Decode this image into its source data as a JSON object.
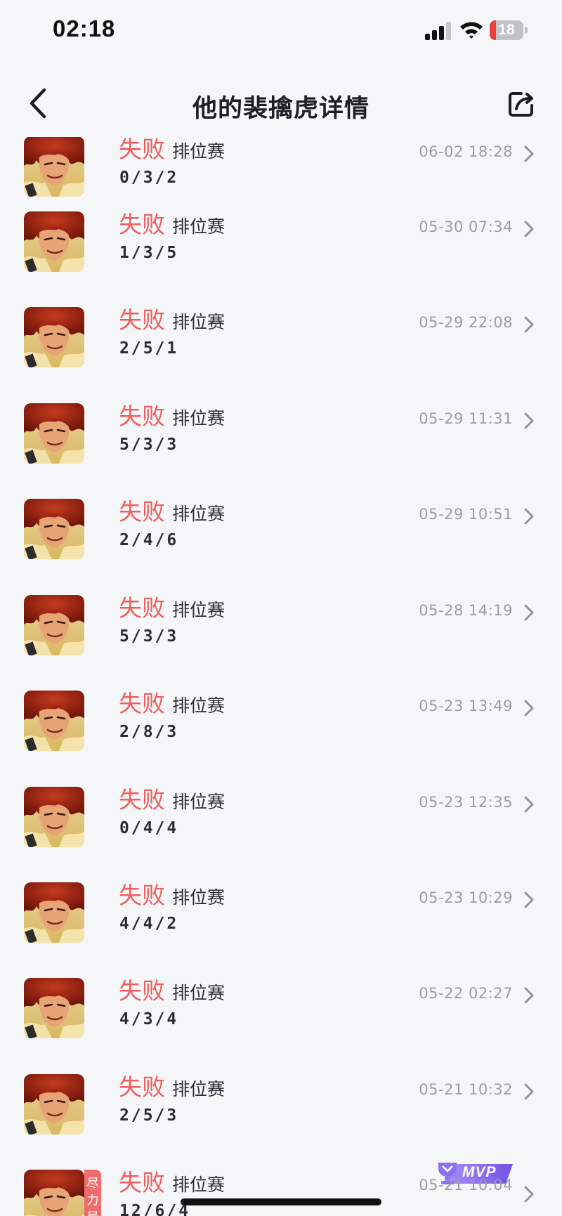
{
  "status_bar": {
    "time": "02:18",
    "battery": "18",
    "battery_level": 0.18
  },
  "nav": {
    "title": "他的裴擒虎详情"
  },
  "matches": [
    {
      "result": "失败",
      "mode": "排位赛",
      "kda": "0/3/2",
      "time": "06-02 18:28"
    },
    {
      "result": "失败",
      "mode": "排位赛",
      "kda": "1/3/5",
      "time": "05-30 07:34"
    },
    {
      "result": "失败",
      "mode": "排位赛",
      "kda": "2/5/1",
      "time": "05-29 22:08"
    },
    {
      "result": "失败",
      "mode": "排位赛",
      "kda": "5/3/3",
      "time": "05-29 11:31"
    },
    {
      "result": "失败",
      "mode": "排位赛",
      "kda": "2/4/6",
      "time": "05-29 10:51"
    },
    {
      "result": "失败",
      "mode": "排位赛",
      "kda": "5/3/3",
      "time": "05-28 14:19"
    },
    {
      "result": "失败",
      "mode": "排位赛",
      "kda": "2/8/3",
      "time": "05-23 13:49"
    },
    {
      "result": "失败",
      "mode": "排位赛",
      "kda": "0/4/4",
      "time": "05-23 12:35"
    },
    {
      "result": "失败",
      "mode": "排位赛",
      "kda": "4/4/2",
      "time": "05-23 10:29"
    },
    {
      "result": "失败",
      "mode": "排位赛",
      "kda": "4/3/4",
      "time": "05-22 02:27"
    },
    {
      "result": "失败",
      "mode": "排位赛",
      "kda": "2/5/3",
      "time": "05-21 10:32"
    },
    {
      "result": "失败",
      "mode": "排位赛",
      "kda": "12/6/4",
      "time": "05-21 10:04",
      "badge": "尽力局",
      "mvp": "MVP"
    }
  ],
  "colors": {
    "loss": "#ef5d5d",
    "time": "#9a9da5",
    "background": "#f5f6f8",
    "mvp": "#8b6cf0"
  },
  "icons": {
    "back": "chevron-left-icon",
    "share": "share-icon",
    "row_arrow": "chevron-right-icon"
  }
}
